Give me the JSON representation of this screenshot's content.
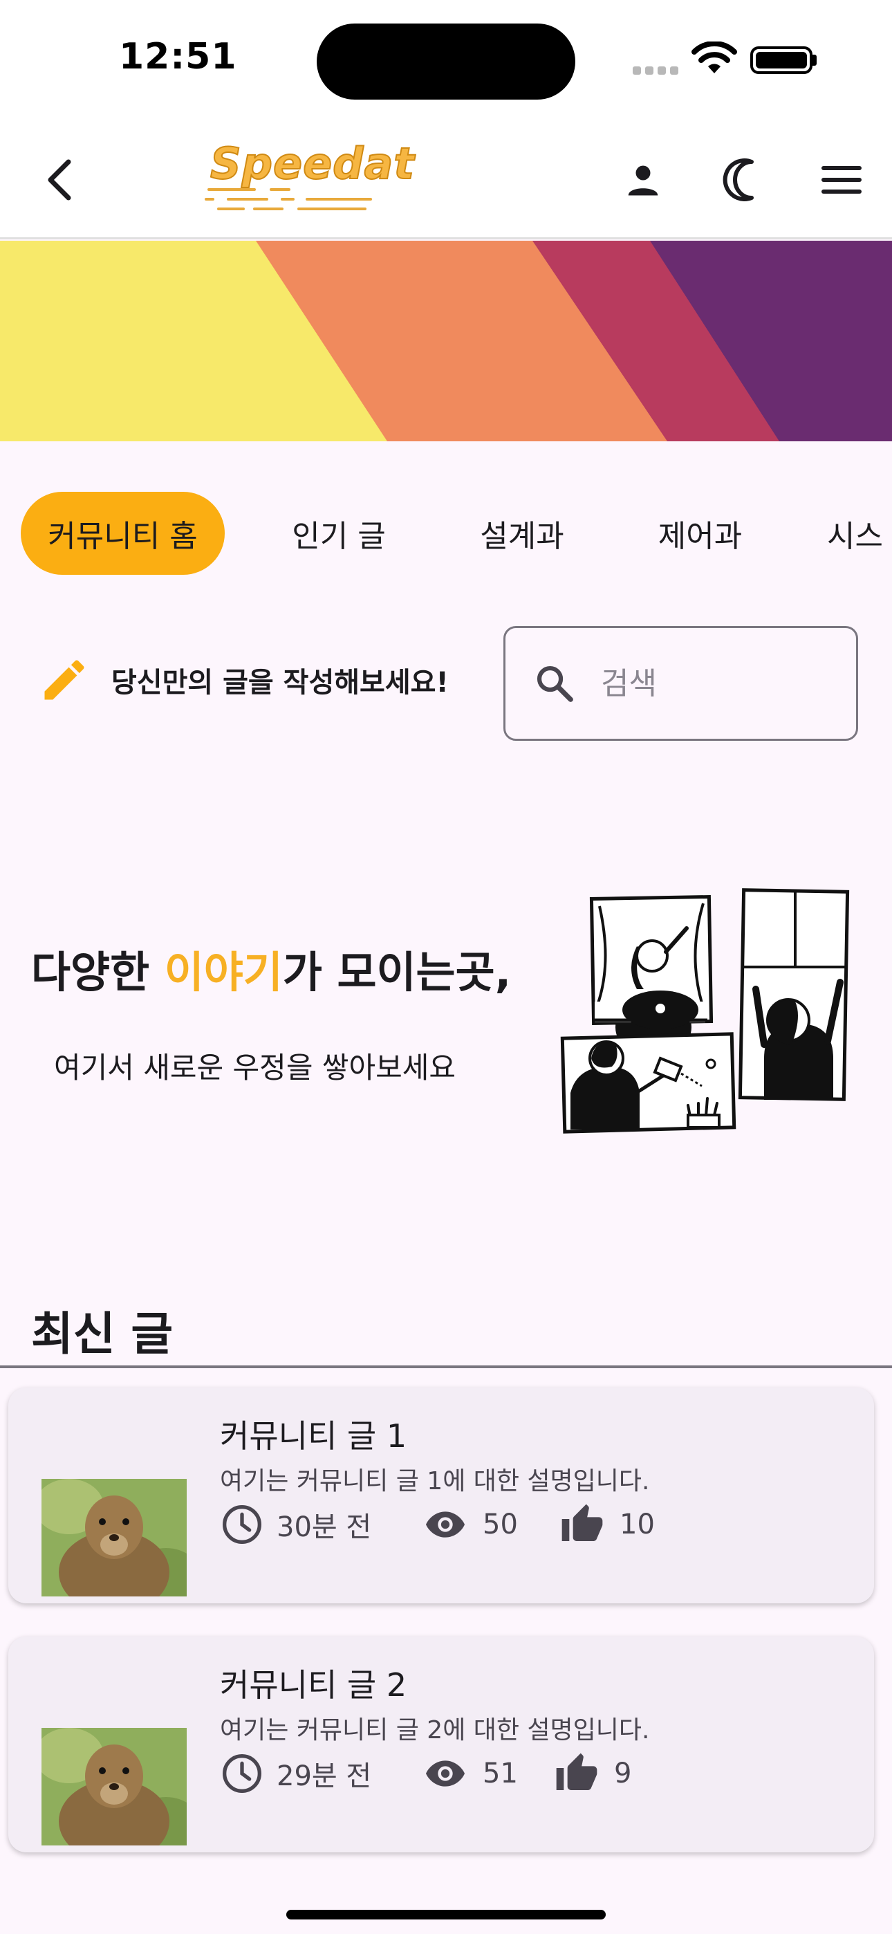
{
  "status_bar": {
    "time": "12:51"
  },
  "app_bar": {
    "logo_text": "Speedat",
    "icons": [
      "back-arrow-icon",
      "person-icon",
      "moon-icon",
      "menu-icon"
    ]
  },
  "banner": {
    "colors": [
      "#f7e96a",
      "#f08a5d",
      "#b83b5e",
      "#6a2c70"
    ]
  },
  "tabs": [
    {
      "label": "커뮤니티 홈",
      "active": true
    },
    {
      "label": "인기 글",
      "active": false
    },
    {
      "label": "설계과",
      "active": false
    },
    {
      "label": "제어과",
      "active": false
    },
    {
      "label": "시스",
      "active": false
    }
  ],
  "write": {
    "label": "당신만의 글을 작성해보세요!"
  },
  "search": {
    "placeholder": "검색"
  },
  "hero": {
    "title_prefix": "다양한 ",
    "title_accent": "이야기",
    "title_suffix": "가 모이는곳,",
    "subtitle": "여기서 새로운 우정을 쌓아보세요"
  },
  "section": {
    "title": "최신 글"
  },
  "posts": [
    {
      "title": "커뮤니티 글 1",
      "description": "여기는 커뮤니티 글 1에 대한 설명입니다.",
      "time": "30분 전",
      "views": "50",
      "likes": "10"
    },
    {
      "title": "커뮤니티 글 2",
      "description": "여기는 커뮤니티 글 2에 대한 설명입니다.",
      "time": "29분 전",
      "views": "51",
      "likes": "9"
    }
  ],
  "colors": {
    "accent": "#fbae12",
    "background": "#fdf6fd",
    "card": "#f3edf5"
  }
}
